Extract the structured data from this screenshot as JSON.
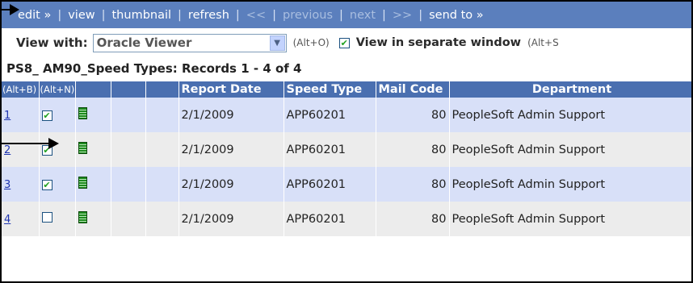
{
  "toolbar": {
    "items": [
      {
        "label": "edit »",
        "disabled": false
      },
      {
        "label": "view",
        "disabled": false
      },
      {
        "label": "thumbnail",
        "disabled": false
      },
      {
        "label": "refresh",
        "disabled": false
      },
      {
        "label": "<<",
        "disabled": true
      },
      {
        "label": "previous",
        "disabled": true
      },
      {
        "label": "next",
        "disabled": true
      },
      {
        "label": ">>",
        "disabled": true
      },
      {
        "label": "send to »",
        "disabled": false
      }
    ],
    "separator": "|"
  },
  "view_with": {
    "label": "View with:",
    "selected": "Oracle Viewer",
    "hotkey": "(Alt+O)",
    "separate_window_checked": true,
    "separate_window_label": "View in separate window",
    "separate_window_hotkey": "(Alt+S"
  },
  "records_summary": "PS8_ AM90_Speed Types:   Records 1 - 4 of 4",
  "table": {
    "columns": [
      "(Alt+B)",
      "(Alt+N)",
      "",
      "",
      "",
      "Report Date",
      "Speed Type",
      "Mail Code",
      "Department"
    ],
    "rows": [
      {
        "link": "1",
        "checked": true,
        "report_date": "2/1/2009",
        "speed_type": "APP60201",
        "mail_code": "80",
        "department": "PeopleSoft Admin Support"
      },
      {
        "link": "2",
        "checked": true,
        "report_date": "2/1/2009",
        "speed_type": "APP60201",
        "mail_code": "80",
        "department": "PeopleSoft Admin Support"
      },
      {
        "link": "3",
        "checked": true,
        "report_date": "2/1/2009",
        "speed_type": "APP60201",
        "mail_code": "80",
        "department": "PeopleSoft Admin Support"
      },
      {
        "link": "4",
        "checked": false,
        "report_date": "2/1/2009",
        "speed_type": "APP60201",
        "mail_code": "80",
        "department": "PeopleSoft Admin Support"
      }
    ]
  },
  "icons": {
    "checkbox_check": "✔",
    "dropdown_arrow": "▼",
    "report": "green-report-icon"
  },
  "colors": {
    "toolbar_bg": "#5b7fbd",
    "header_bg": "#4a6fb0",
    "row_odd": "#d8e0f8",
    "row_even": "#ececec"
  }
}
